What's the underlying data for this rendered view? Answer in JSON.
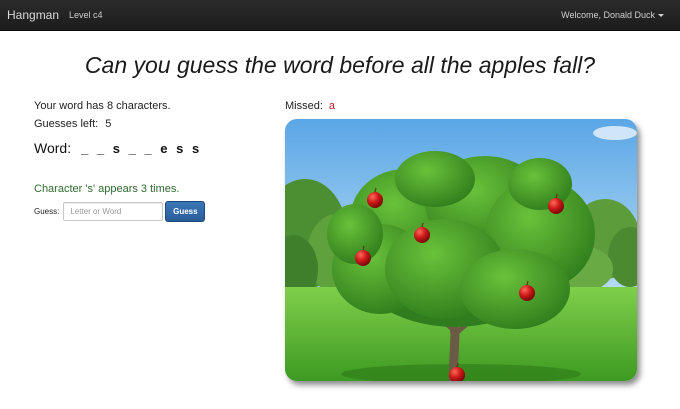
{
  "navbar": {
    "brand": "Hangman",
    "level": "Level c4",
    "user_menu": "Welcome, Donald Duck"
  },
  "title": "Can you guess the word before all the apples fall?",
  "game": {
    "word_length_text": "Your word has 8 characters.",
    "guesses_left_label": "Guesses left:",
    "guesses_left": "5",
    "word_label": "Word:",
    "word_display": "_ _ s _ _ e s s",
    "message": "Character 's' appears 3 times.",
    "message_color": "#2f6a2f",
    "missed_label": "Missed:",
    "missed_letters": "a",
    "missed_color": "#b22222"
  },
  "form": {
    "guess_label": "Guess:",
    "input_placeholder": "Letter or Word",
    "input_value": "",
    "button_label": "Guess",
    "button_color": "#2f67a7"
  },
  "image": {
    "subject": "apple tree with apples",
    "apples_remaining": 6,
    "apple_color": "#d01b1b"
  }
}
